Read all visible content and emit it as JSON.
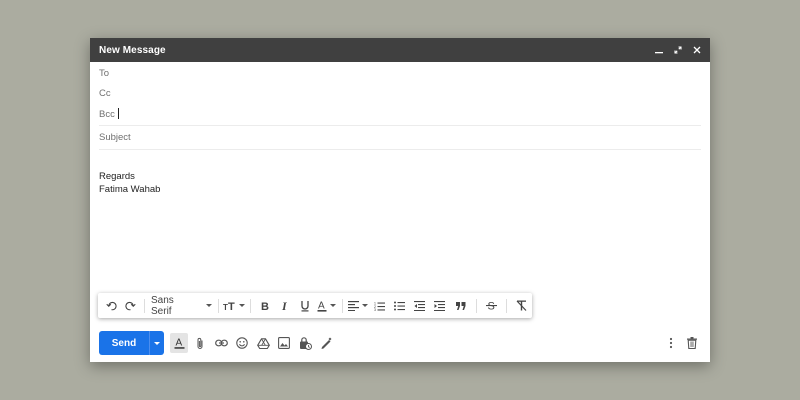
{
  "window": {
    "title": "New Message",
    "controls": [
      "minimize-icon",
      "expand-icon",
      "close-icon"
    ]
  },
  "fields": {
    "to_label": "To",
    "cc_label": "Cc",
    "bcc_label": "Bcc",
    "subject_placeholder": "Subject"
  },
  "body": {
    "line1": "Regards",
    "line2": "Fatima Wahab"
  },
  "format_toolbar": {
    "font_name": "Sans Serif",
    "tools": [
      "undo-icon",
      "redo-icon",
      "font-size-icon",
      "bold-icon",
      "italic-icon",
      "underline-icon",
      "text-color-icon",
      "align-icon",
      "numbered-list-icon",
      "bulleted-list-icon",
      "indent-less-icon",
      "indent-more-icon",
      "quote-icon",
      "strikethrough-icon",
      "remove-formatting-icon"
    ]
  },
  "bottom_bar": {
    "send_label": "Send",
    "accent_color": "#1a73e8",
    "tools": [
      "formatting-options-icon",
      "attach-icon",
      "link-icon",
      "emoji-icon",
      "drive-icon",
      "photo-icon",
      "confidential-icon",
      "signature-icon",
      "more-options-icon",
      "trash-icon"
    ]
  }
}
